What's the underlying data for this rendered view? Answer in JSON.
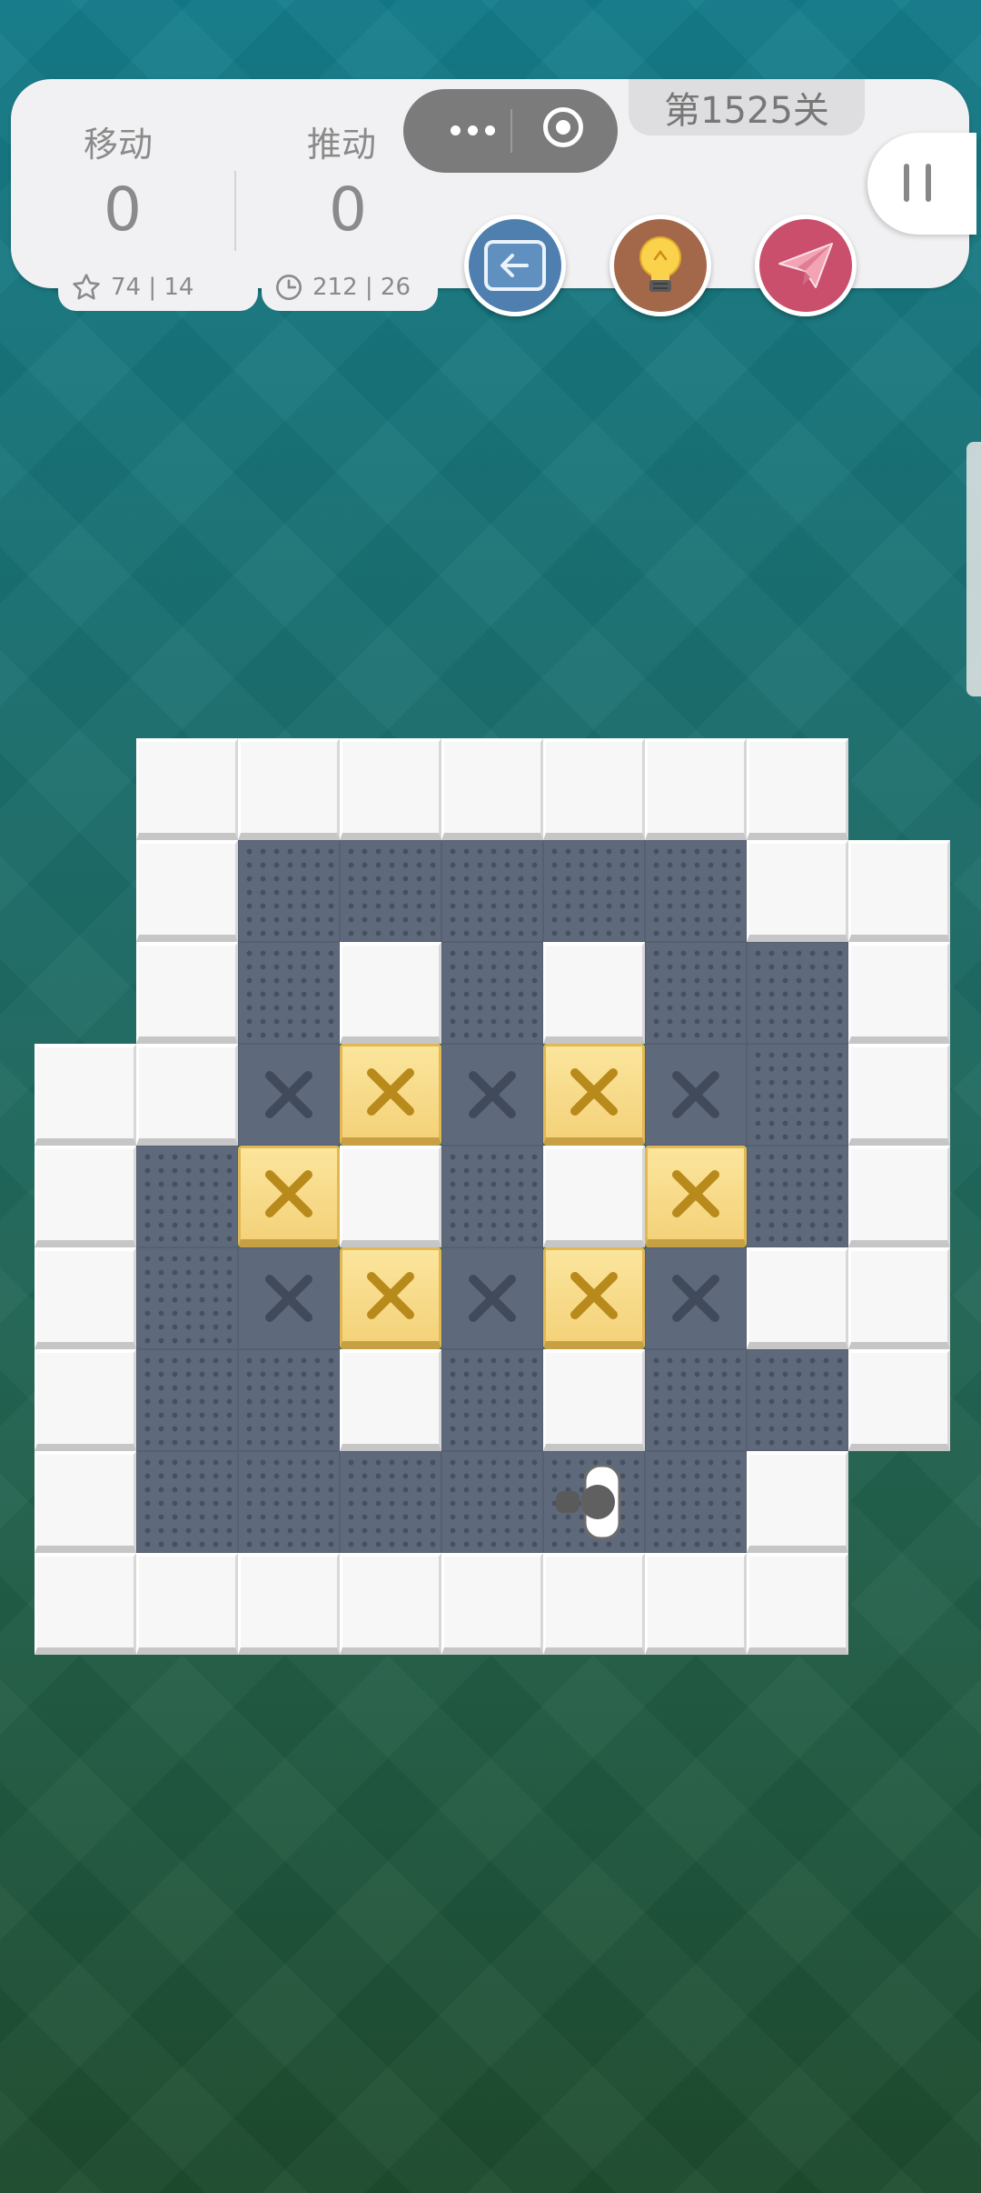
{
  "stats": {
    "moves_label": "移动",
    "moves_value": "0",
    "pushes_label": "推动",
    "pushes_value": "0",
    "star_record": "74 | 14",
    "time_record": "212 | 26"
  },
  "level": {
    "title": "第1525关"
  },
  "buttons": {
    "undo": "undo-arrow-icon",
    "hint": "lightbulb-icon",
    "share": "paper-plane-icon"
  },
  "colors": {
    "undo_bg": "#4f7fae",
    "hint_bg": "#a3684a",
    "share_bg": "#c94f6d",
    "box": "#f6d37c",
    "floor": "#5e6a7c",
    "wall": "#f7f7f7"
  },
  "board": {
    "grid": [
      ".#######.",
      ".#.....##",
      ".#.#.#..#",
      "##+*+*+.#",
      "#.*#.#*.#",
      "#.+*+*+##",
      "#..#.#..#.",
      "#....@.#.",
      "########."
    ]
  }
}
